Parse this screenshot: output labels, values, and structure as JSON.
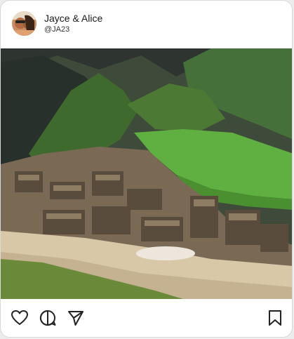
{
  "post": {
    "author_name": "Jayce & Alice",
    "author_handle": "@JA23"
  },
  "photo": {
    "subject": "mountain ruins landscape photo"
  },
  "actions": [
    {
      "icon": "heart-icon"
    },
    {
      "icon": "comment-icon"
    },
    {
      "icon": "send-icon"
    },
    {
      "icon": "bookmark-icon"
    }
  ],
  "colors": {
    "card_bg": "#ffffff",
    "text": "#1a1a1a",
    "icon": "#222222"
  }
}
